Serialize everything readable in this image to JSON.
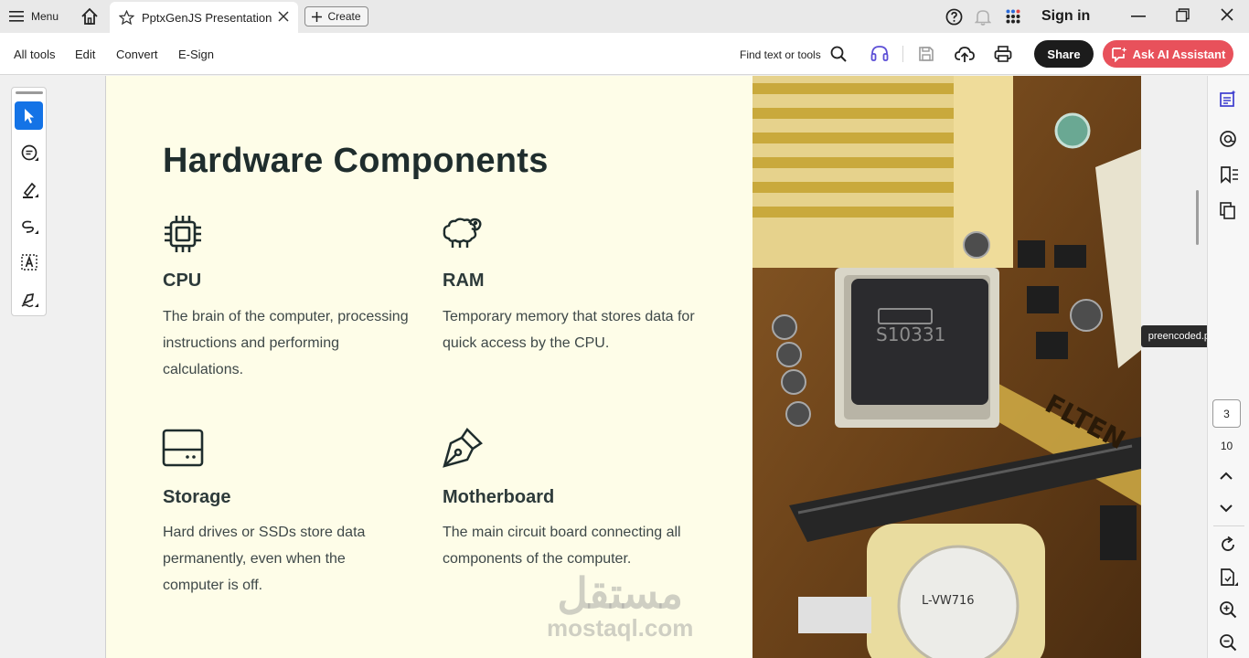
{
  "titlebar": {
    "menu_label": "Menu",
    "tab_title": "PptxGenJS Presentation",
    "create_label": "Create",
    "signin_label": "Sign in"
  },
  "toolbar": {
    "menu_items": [
      "All tools",
      "Edit",
      "Convert",
      "E-Sign"
    ],
    "find_label": "Find text or tools",
    "share_label": "Share",
    "ai_label": "Ask AI Assistant"
  },
  "slide": {
    "title": "Hardware Components",
    "components": [
      {
        "icon": "cpu-icon",
        "title": "CPU",
        "description": "The brain of the computer, processing instructions and performing calculations."
      },
      {
        "icon": "ram-icon",
        "title": "RAM",
        "description": "Temporary memory that stores data for quick access by the CPU."
      },
      {
        "icon": "storage-icon",
        "title": "Storage",
        "description": "Hard drives or SSDs store data permanently, even when the computer is off."
      },
      {
        "icon": "motherboard-icon",
        "title": "Motherboard",
        "description": "The main circuit board connecting all components of the computer."
      }
    ],
    "image_label": "preencoded.png",
    "chip_text": "S10331",
    "board_text": "FLTEN",
    "label_text": "L-VW716"
  },
  "navigation": {
    "current_page": "3",
    "total_pages": "10"
  },
  "watermark": {
    "arabic": "مستقل",
    "latin": "mostaql.com"
  },
  "colors": {
    "accent": "#1473e6",
    "ai_button": "#e8515b",
    "slide_bg": "#fefde8",
    "heading": "#1f2d2d"
  }
}
